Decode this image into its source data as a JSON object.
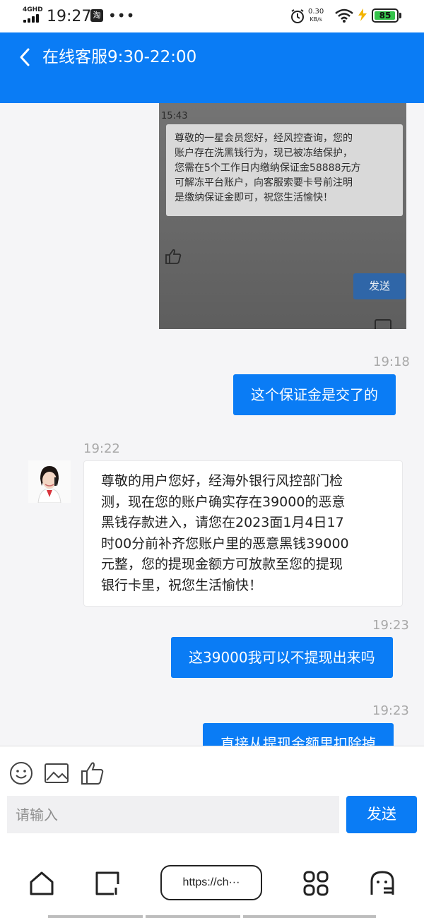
{
  "status_bar": {
    "network": "4GHD",
    "time": "19:27",
    "app_badge": "淘",
    "more": "•••",
    "speed_value": "0.30",
    "speed_unit": "KB/s",
    "battery": "85"
  },
  "header": {
    "title": "在线客服9:30-22:00"
  },
  "screenshot_image": {
    "time": "15:43",
    "message_lines": [
      "尊敬的一星会员您好，经风控查询，您的",
      "账户存在洗黑钱行为，现已被冻结保护，",
      "您需在5个工作日内缴纳保证金58888元方",
      "可解冻平台账户，向客服索要卡号前注明",
      "是缴纳保证金即可，祝您生活愉快！"
    ],
    "send_label": "发送"
  },
  "messages": [
    {
      "direction": "out",
      "time": "19:18",
      "text": "这个保证金是交了的"
    },
    {
      "direction": "in",
      "time": "19:22",
      "lines": [
        "尊敬的用户您好，经海外银行风控部门检",
        "测，现在您的账户确实存在39000的恶意",
        "黑钱存款进入，请您在2023面1月4日17",
        "时00分前补齐您账户里的恶意黑钱39000",
        "元整，您的提现金额方可放款至您的提现",
        "银行卡里，祝您生活愉快！"
      ]
    },
    {
      "direction": "out",
      "time": "19:23",
      "text": "这39000我可以不提现出来吗"
    },
    {
      "direction": "out",
      "time": "19:23",
      "text": "直接从提现金额里扣除掉"
    }
  ],
  "input": {
    "placeholder": "请输入",
    "send_label": "发送"
  },
  "browser": {
    "url": "https://ch···"
  }
}
